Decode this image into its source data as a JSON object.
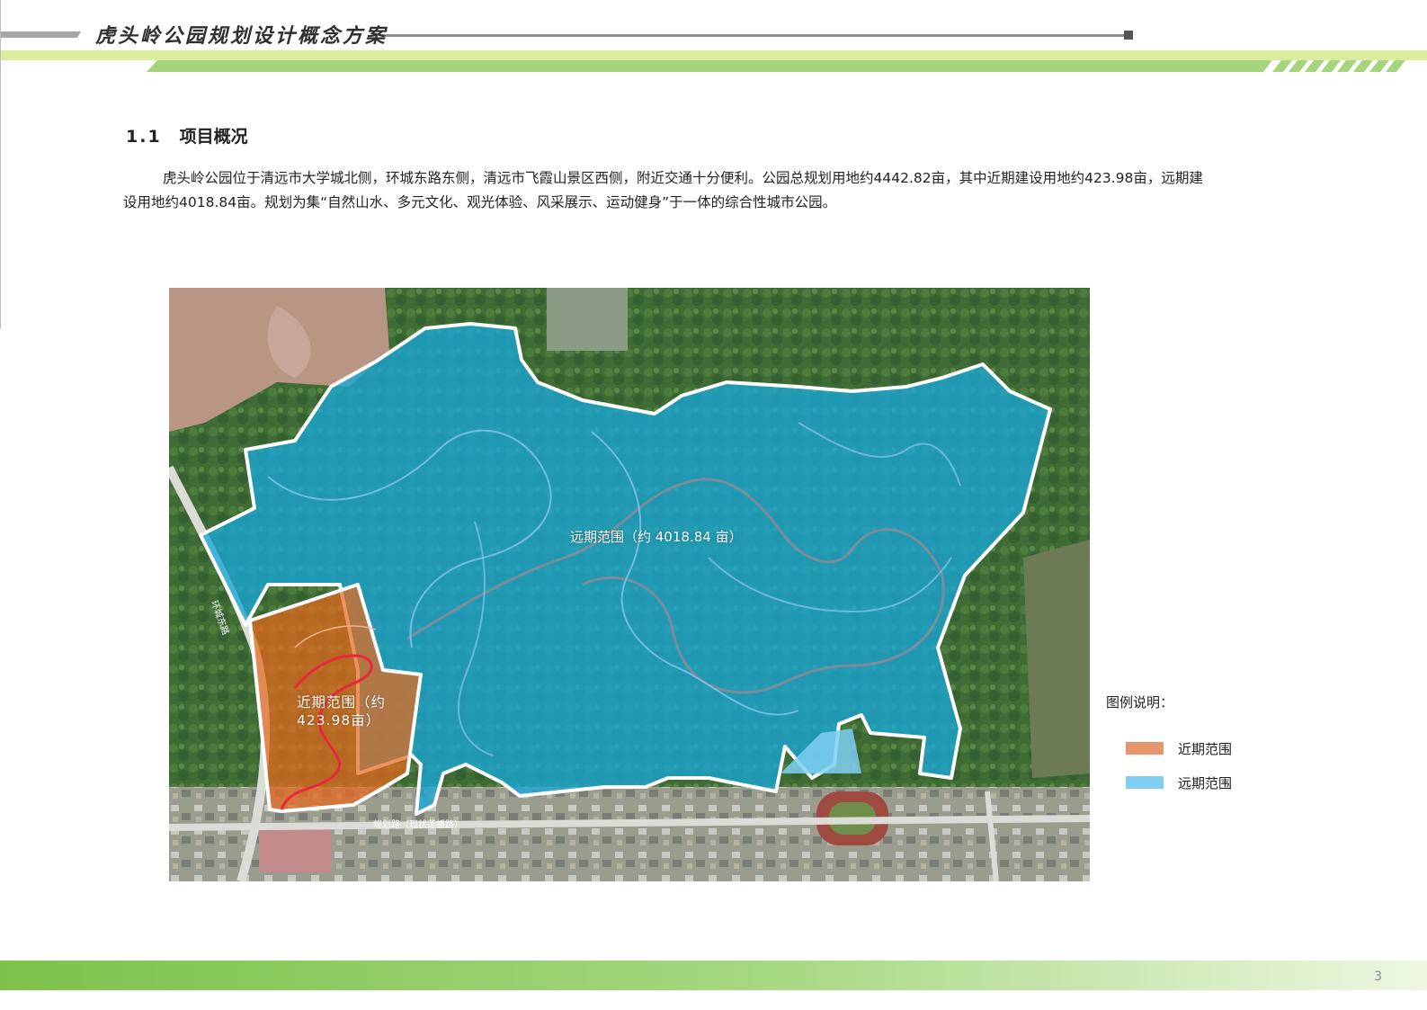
{
  "header": {
    "title": "虎头岭公园规划设计概念方案"
  },
  "section": {
    "number": "1.1",
    "title": "项目概况"
  },
  "body": {
    "paragraph": "虎头岭公园位于清远市大学城北侧，环城东路东侧，清远市飞霞山景区西侧，附近交通十分便利。公园总规划用地约4442.82亩，其中近期建设用地约423.98亩，远期建设用地约4018.84亩。规划为集“自然山水、多元文化、观光体验、风采展示、运动健身”于一体的综合性城市公园。"
  },
  "map": {
    "far_label": "远期范围（约 4018.84 亩）",
    "near_label": "近期范围（约423.98亩）",
    "road_east": "环城东路",
    "road_south": "规划路（现状莲蟠路）"
  },
  "legend": {
    "title": "图例说明：",
    "items": [
      {
        "label": "近期范围",
        "color": "#e8956b"
      },
      {
        "label": "远期范围",
        "color": "#7ecff2"
      }
    ]
  },
  "colors": {
    "header_green": "#d9ea9c",
    "header_green_dark": "#a8d27a",
    "footer_green_start": "#7cc24a",
    "footer_green_end": "#f0f7e0",
    "far_fill": "#1aa6d6",
    "near_fill": "#e86a1d"
  },
  "footer": {
    "page_number": "3"
  }
}
